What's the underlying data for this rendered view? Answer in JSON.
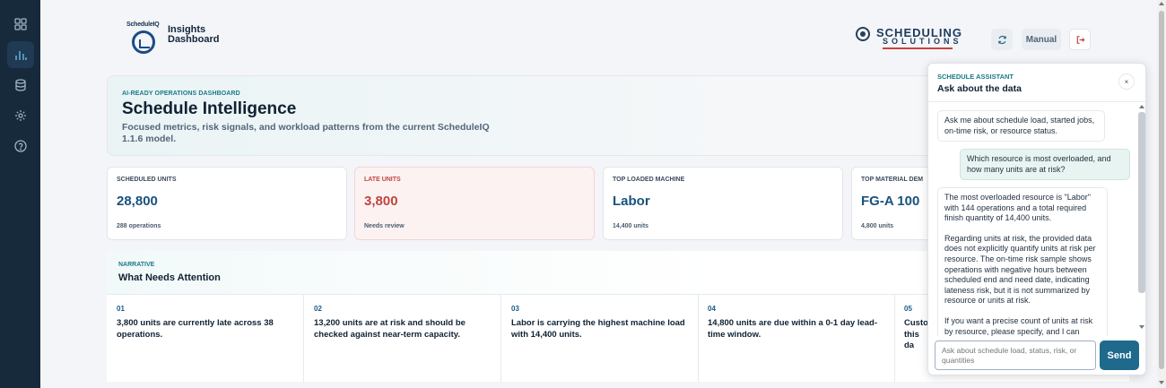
{
  "sidebar": {
    "items": [
      {
        "icon": "grid-icon",
        "active": false
      },
      {
        "icon": "bar-chart-icon",
        "active": true
      },
      {
        "icon": "database-icon",
        "active": false
      },
      {
        "icon": "gear-icon",
        "active": false
      },
      {
        "icon": "help-icon",
        "active": false
      }
    ]
  },
  "header": {
    "logo_small": "ScheduleIQ",
    "logo_line1": "Insights",
    "logo_line2": "Dashboard",
    "brand_line1": "SCHEDULING",
    "brand_line2": "SOLUTIONS",
    "refresh_icon": "refresh-icon",
    "manual_label": "Manual",
    "logout_icon": "logout-icon"
  },
  "hero": {
    "kicker": "AI-READY OPERATIONS DASHBOARD",
    "title": "Schedule Intelligence",
    "subtitle": "Focused metrics, risk signals, and workload patterns from the current ScheduleIQ 1.1.6 model."
  },
  "metrics": [
    {
      "label": "SCHEDULED UNITS",
      "value": "28,800",
      "foot": "288 operations"
    },
    {
      "label": "LATE UNITS",
      "value": "3,800",
      "foot": "Needs review"
    },
    {
      "label": "TOP LOADED MACHINE",
      "value": "Labor",
      "foot": "14,400 units"
    },
    {
      "label": "TOP MATERIAL DEM",
      "value": "FG-A 100",
      "foot": "4,800 units"
    }
  ],
  "narrative": {
    "kicker": "NARRATIVE",
    "title": "What Needs Attention",
    "items": [
      {
        "num": "01",
        "text": "3,800 units are currently late across 38 operations."
      },
      {
        "num": "02",
        "text": "13,200 units are at risk and should be checked against near-term capacity."
      },
      {
        "num": "03",
        "text": "Labor is carrying the highest machine load with 14,400 units."
      },
      {
        "num": "04",
        "text": "14,800 units are due within a 0-1 day lead-time window."
      },
      {
        "num": "05",
        "text": "Custo this da"
      }
    ]
  },
  "chat": {
    "kicker": "SCHEDULE ASSISTANT",
    "title": "Ask about the data",
    "close_label": "×",
    "messages": [
      {
        "role": "bot",
        "paragraphs": [
          "Ask me about schedule load, started jobs, on-time risk, or resource status."
        ]
      },
      {
        "role": "user",
        "paragraphs": [
          "Which resource is most overloaded, and how many units are at risk?"
        ]
      },
      {
        "role": "bot",
        "paragraphs": [
          "The most overloaded resource is \"Labor\" with 144 operations and a total required finish quantity of 14,400 units.",
          "Regarding units at risk, the provided data does not explicitly quantify units at risk per resource. The on-time risk sample shows operations with negative hours between scheduled end and need date, indicating lateness risk, but it is not summarized by resource or units at risk.",
          "If you want a precise count of units at risk by resource, please specify, and I can"
        ]
      }
    ],
    "input_placeholder": "Ask about schedule load, status, risk, or quantities",
    "send_label": "Send"
  }
}
